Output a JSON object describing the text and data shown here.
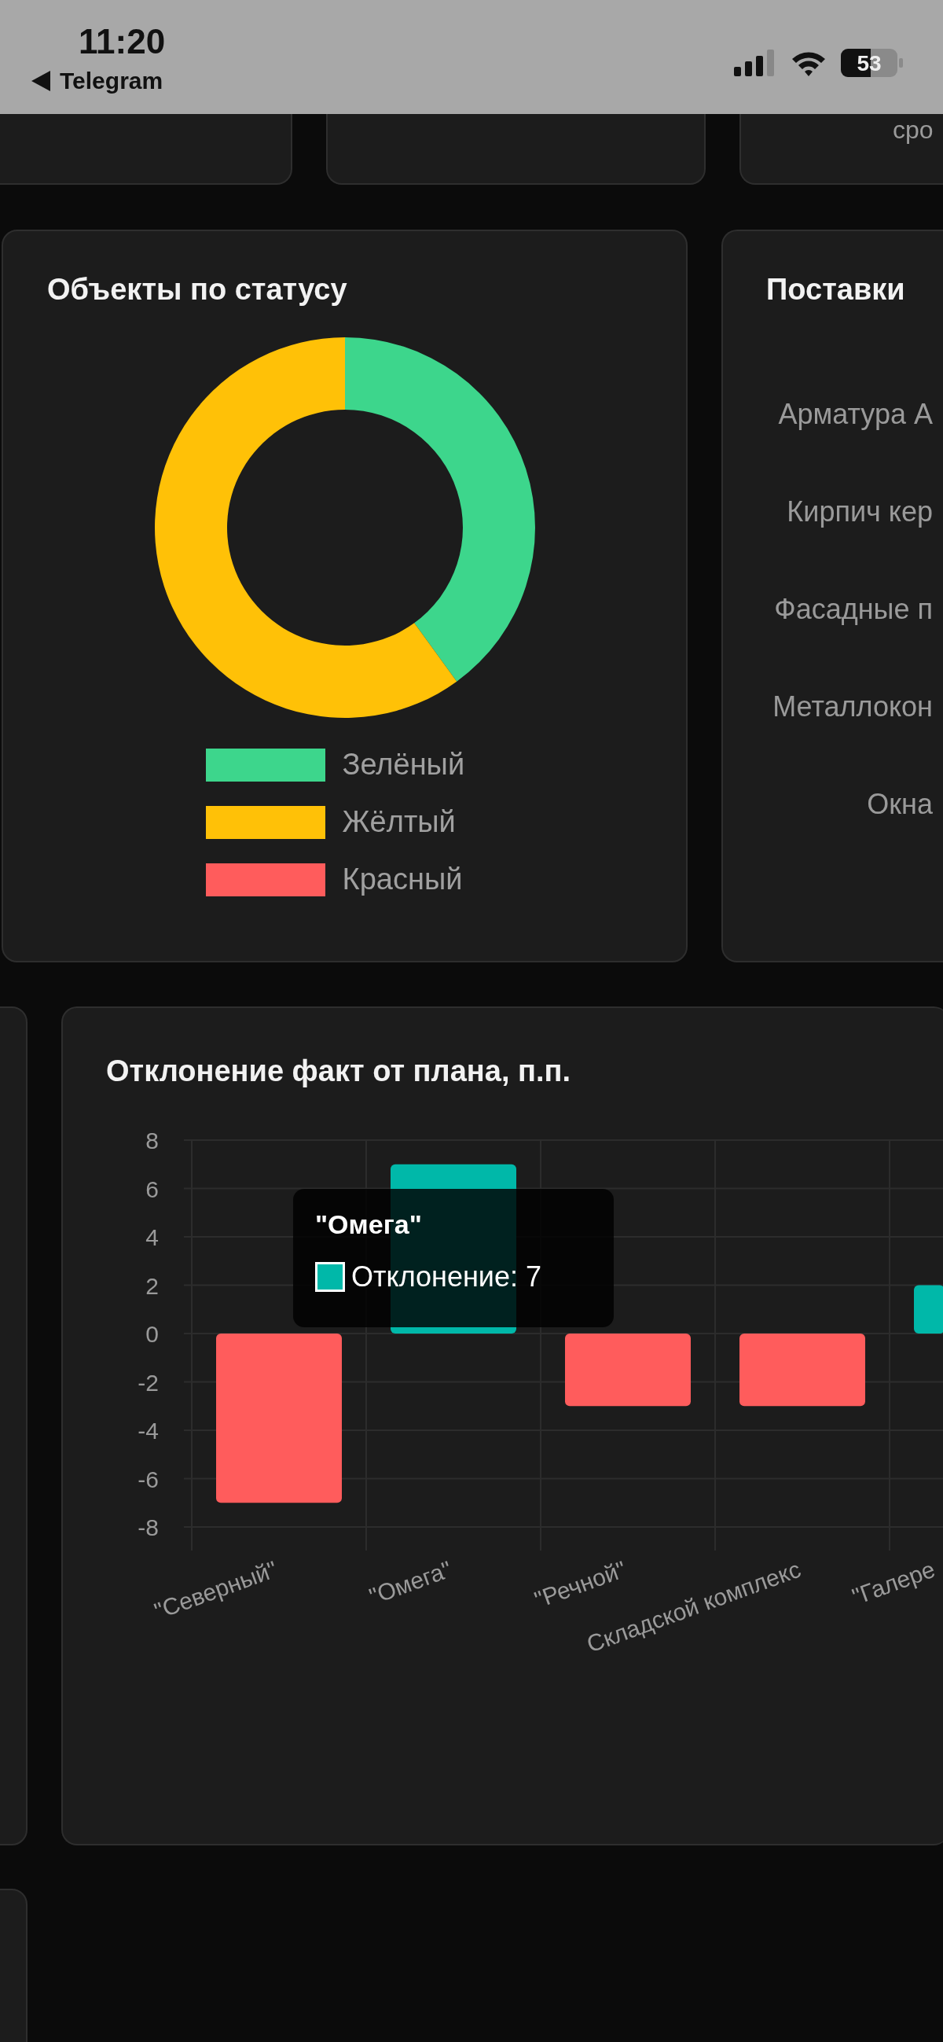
{
  "status_bar": {
    "time": "11:20",
    "back_label": "Telegram",
    "battery_text": "53"
  },
  "top_row": {
    "partial_text": "сро"
  },
  "status_card": {
    "title": "Объекты по статусу",
    "chart_data": {
      "type": "donut",
      "categories": [
        "Зелёный",
        "Жёлтый",
        "Красный"
      ],
      "values": [
        40,
        60,
        0
      ],
      "colors": [
        "#3dd68c",
        "#ffc107",
        "#ff5c5c"
      ]
    }
  },
  "deliveries_card": {
    "title": "Поставки",
    "items": [
      "Арматура А",
      "Кирпич кер",
      "Фасадные п",
      "Металлокон",
      "Окна"
    ]
  },
  "deviation_card": {
    "title": "Отклонение факт от плана, п.п.",
    "chart_data": {
      "type": "bar",
      "categories": [
        "\"Северный\"",
        "\"Омега\"",
        "\"Речной\"",
        "Складской комплекс",
        "\"Галере"
      ],
      "series": [
        {
          "name": "Отклонение",
          "color": "#00b8a9",
          "colors": [
            "#ff5c5c",
            "#00b8a9",
            "#ff5c5c",
            "#ff5c5c",
            "#00b8a9"
          ],
          "values": [
            -7,
            7,
            -3,
            -3,
            2
          ]
        }
      ],
      "grid": true,
      "ylim": [
        -8,
        8
      ],
      "yticks": [
        -8,
        -6,
        -4,
        -2,
        0,
        2,
        4,
        6,
        8
      ]
    },
    "tooltip": {
      "title": "\"Омега\"",
      "value_text": ": 7"
    }
  }
}
